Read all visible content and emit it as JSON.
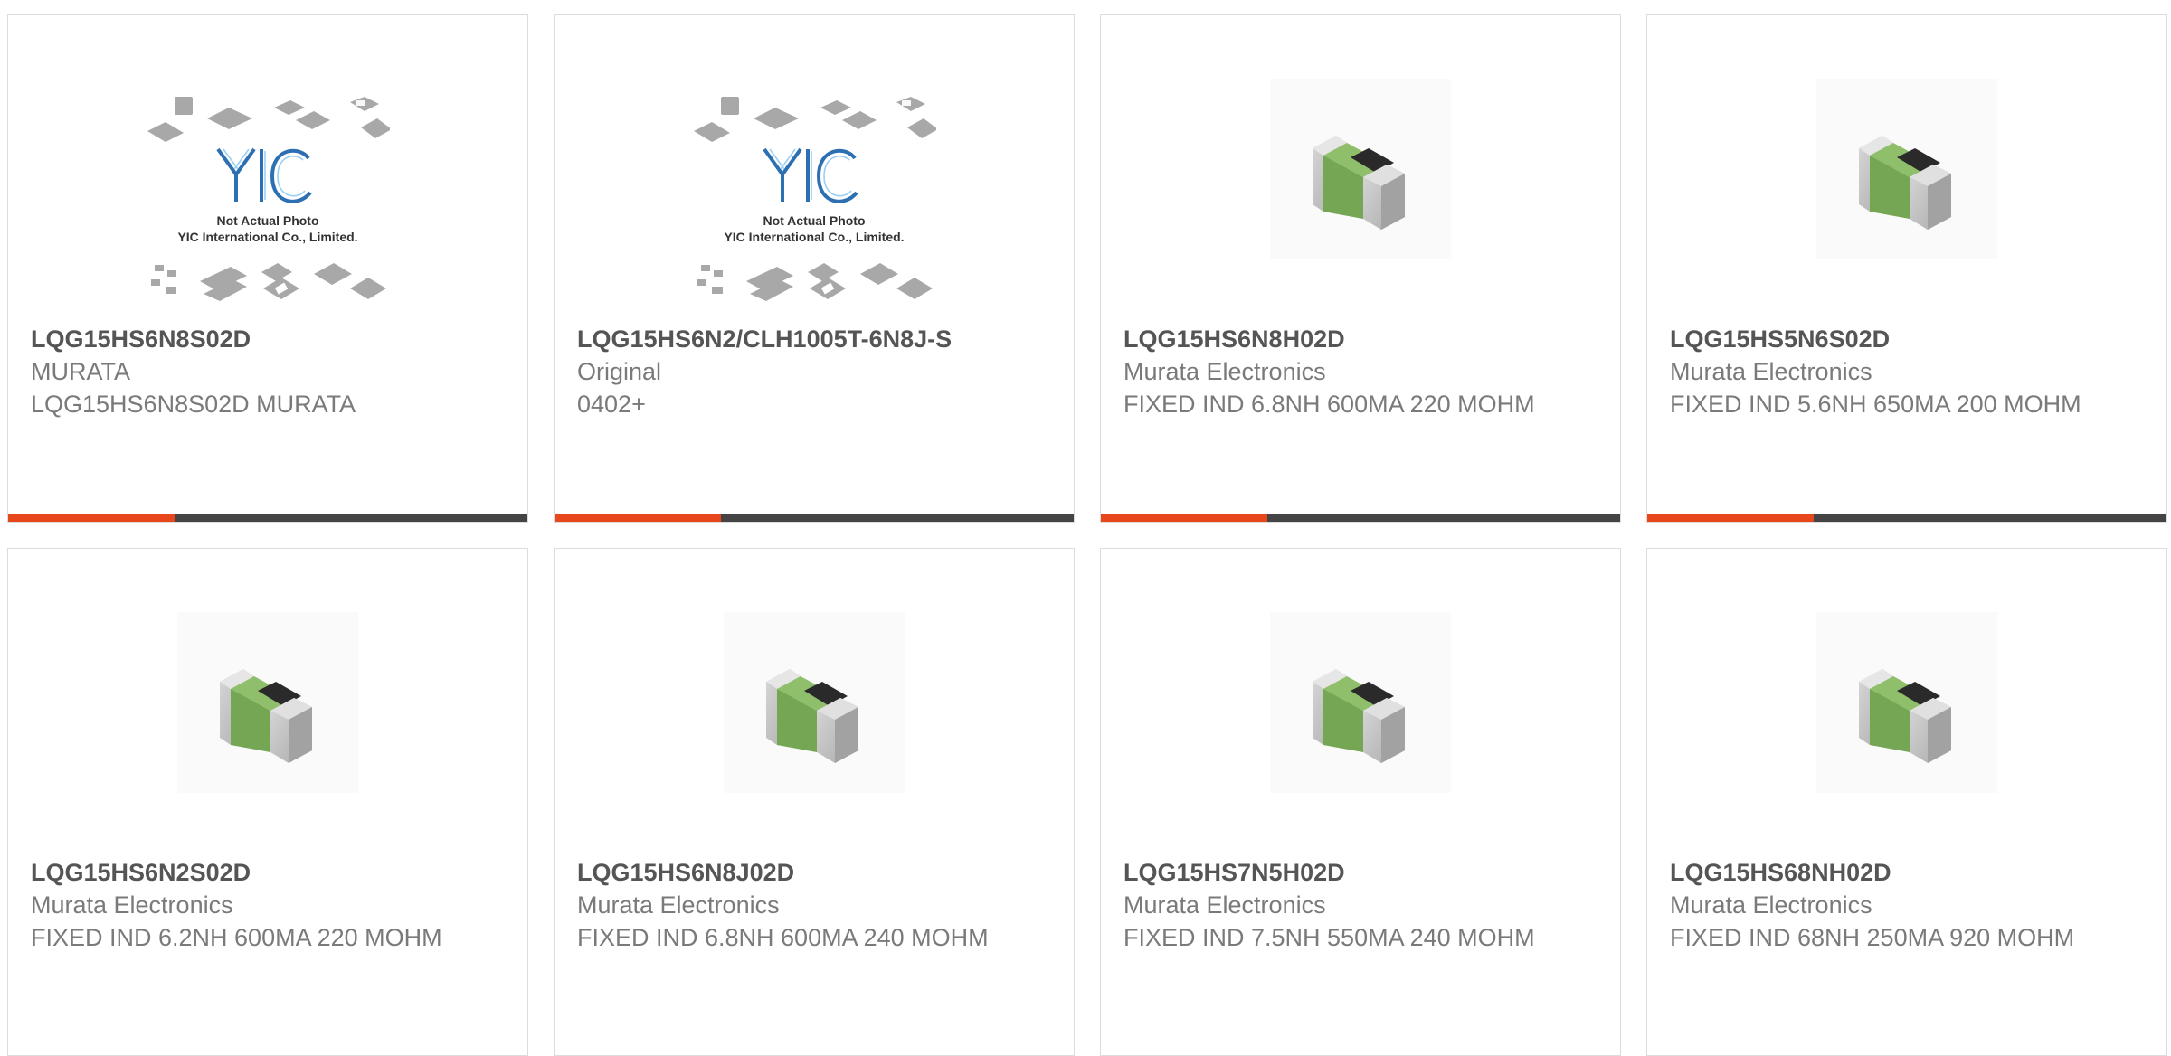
{
  "colors": {
    "accent": "#e8461d",
    "track": "#444444",
    "border": "#dcdcdc",
    "title": "#555555",
    "text": "#7a7a7a"
  },
  "placeholder": {
    "line1": "Not Actual Photo",
    "line2": "YIC International Co., Limited."
  },
  "cards": [
    {
      "title": "LQG15HS6N8S02D",
      "lines": [
        "MURATA",
        "LQG15HS6N8S02D MURATA"
      ],
      "image": "yic-placeholder-image",
      "progress": 0.32
    },
    {
      "title": "LQG15HS6N2/CLH1005T-6N8J-S",
      "lines": [
        "Original",
        "0402+"
      ],
      "image": "yic-placeholder-image",
      "progress": 0.32
    },
    {
      "title": "LQG15HS6N8H02D",
      "lines": [
        "Murata Electronics",
        "FIXED IND 6.8NH 600MA 220 MOHM"
      ],
      "image": "smd-inductor-image",
      "progress": 0.32
    },
    {
      "title": "LQG15HS5N6S02D",
      "lines": [
        "Murata Electronics",
        "FIXED IND 5.6NH 650MA 200 MOHM"
      ],
      "image": "smd-inductor-image",
      "progress": 0.32
    },
    {
      "title": "LQG15HS6N2S02D",
      "lines": [
        "Murata Electronics",
        "FIXED IND 6.2NH 600MA 220 MOHM"
      ],
      "image": "smd-inductor-image"
    },
    {
      "title": "LQG15HS6N8J02D",
      "lines": [
        "Murata Electronics",
        "FIXED IND 6.8NH 600MA 240 MOHM"
      ],
      "image": "smd-inductor-image"
    },
    {
      "title": "LQG15HS7N5H02D",
      "lines": [
        "Murata Electronics",
        "FIXED IND 7.5NH 550MA 240 MOHM"
      ],
      "image": "smd-inductor-image"
    },
    {
      "title": "LQG15HS68NH02D",
      "lines": [
        "Murata Electronics",
        "FIXED IND 68NH 250MA 920 MOHM"
      ],
      "image": "smd-inductor-image"
    }
  ]
}
